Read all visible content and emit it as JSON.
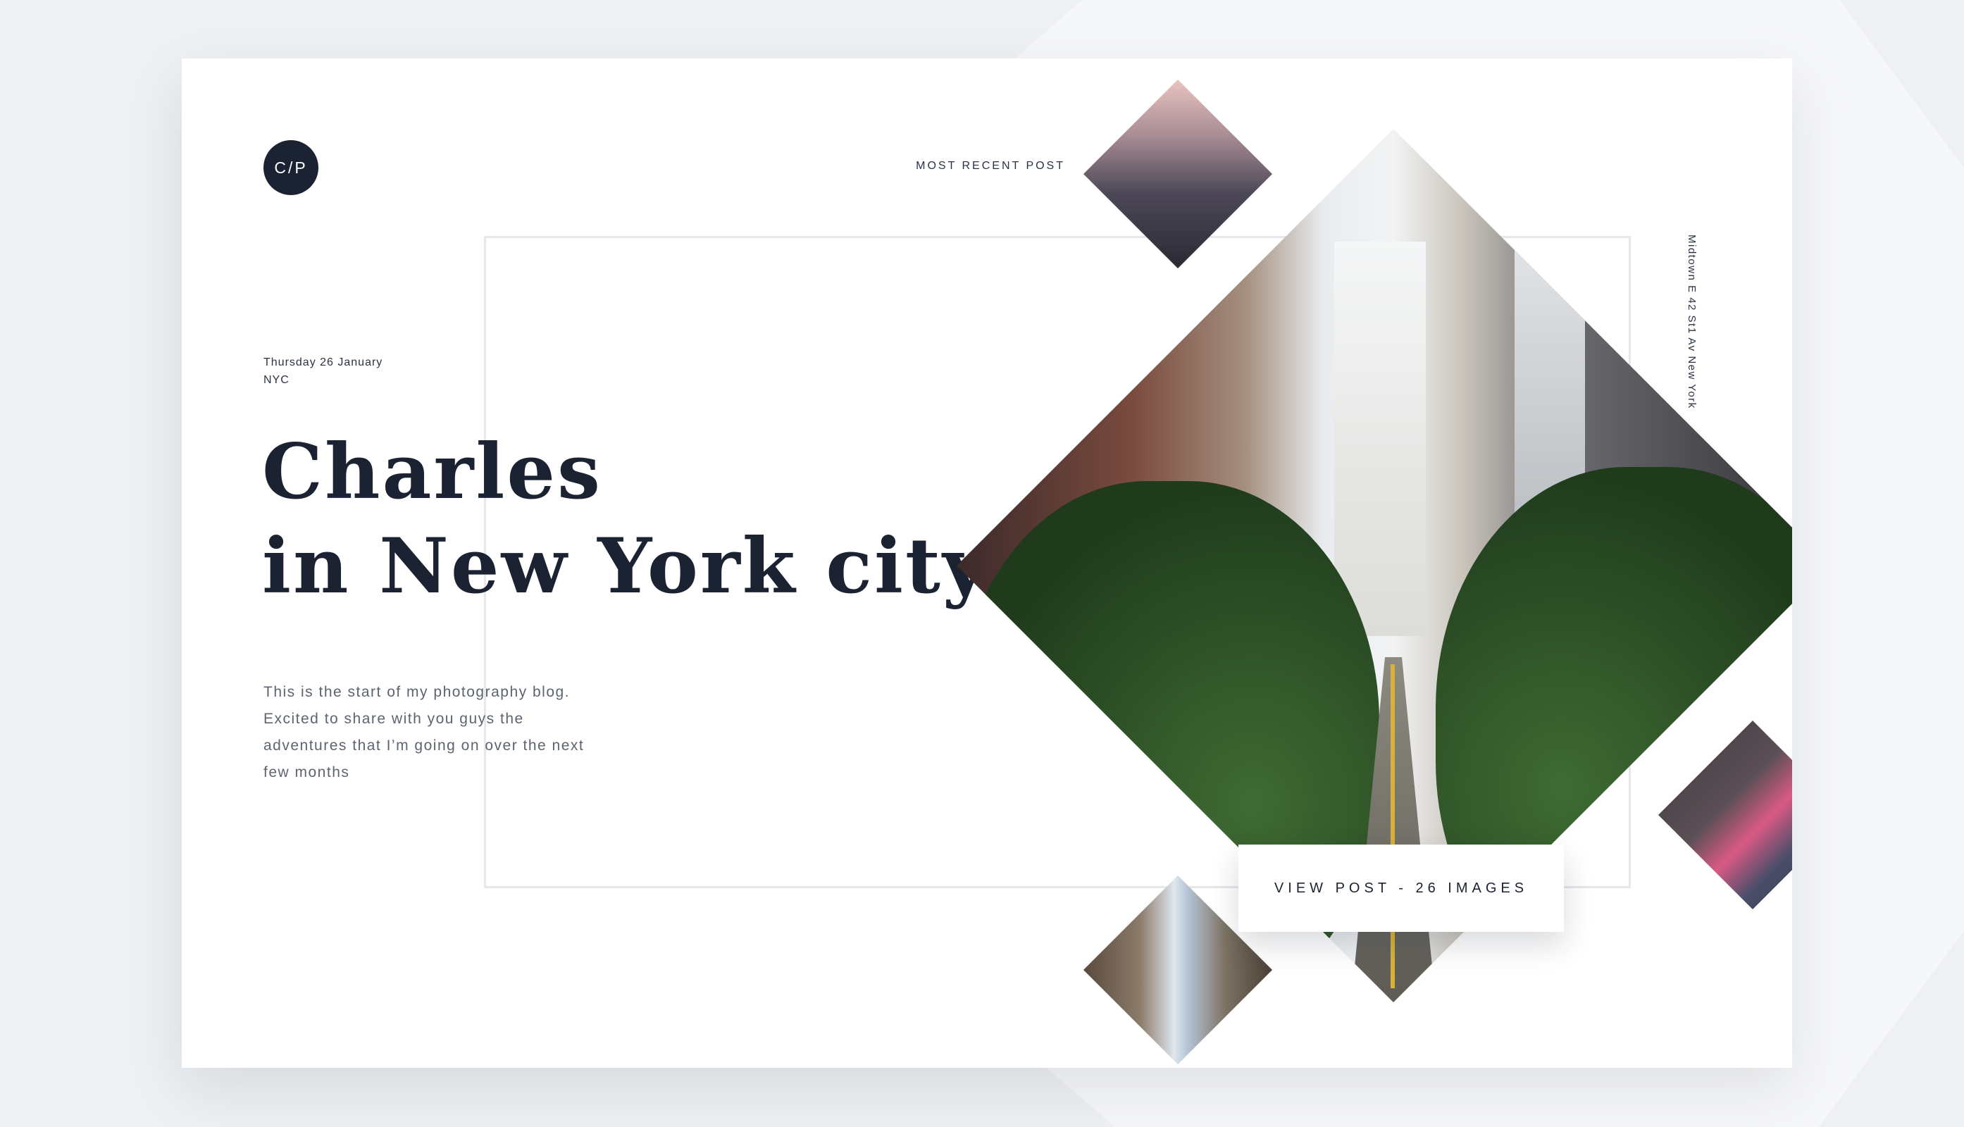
{
  "brand": {
    "logo_text": "C/P"
  },
  "header": {
    "most_recent_label": "MOST RECENT POST"
  },
  "post": {
    "date": "Thursday 26 January",
    "place": "NYC",
    "title_line1": "Charles",
    "title_line2": "in New York city",
    "description": "This is the start of my photography blog. Excited to share with you guys the adventures that I’m going on over the next few months",
    "view_button": "VIEW POST - 26 IMAGES",
    "location_line1": "Midtown E 42 St1 Av",
    "location_line2": "New York"
  },
  "colors": {
    "ink": "#1b2333",
    "muted": "#5d6470",
    "frame": "#e5e7ea"
  }
}
